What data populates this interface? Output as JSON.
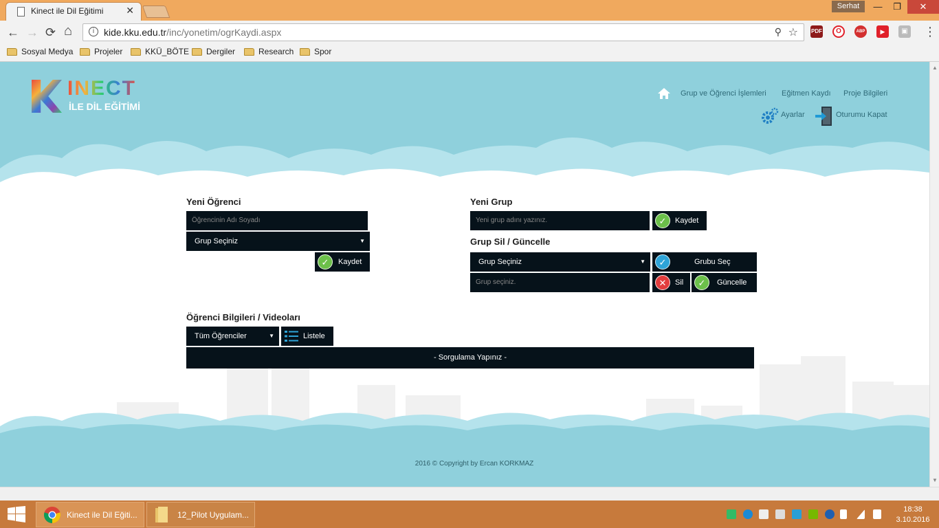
{
  "browser": {
    "tab_title": "Kinect ile Dil Eğitimi",
    "tab_close": "✕",
    "user_name": "Serhat",
    "win_min": "—",
    "win_max": "❐",
    "win_close": "✕",
    "url_domain": "kide.kku.edu.tr",
    "url_path": "/inc/yonetim/ogrKaydi.aspx",
    "back": "←",
    "forward": "→",
    "reload": "⟳",
    "home": "⌂",
    "zoom_icon": "⚲",
    "star_icon": "☆",
    "menu_icon": "⋮",
    "extensions": [
      "PDF",
      "O",
      "ABP",
      "▶",
      "▣"
    ],
    "bookmarks": [
      "Sosyal Medya",
      "Projeler",
      "KKÜ_BÖTE",
      "Dergiler",
      "Research",
      "Spor"
    ]
  },
  "site": {
    "logo_letter": "K",
    "logo_word": "INECT",
    "logo_sub": "İLE DİL EĞİTİMİ",
    "nav": {
      "group_student": "Grup ve Öğrenci İşlemleri",
      "trainer": "Eğitmen Kaydı",
      "project": "Proje Bilgileri",
      "settings": "Ayarlar",
      "logout": "Oturumu Kapat"
    }
  },
  "new_student": {
    "title": "Yeni Öğrenci",
    "name_placeholder": "Öğrencinin Adı Soyadı",
    "group_select": "Grup Seçiniz",
    "save": "Kaydet"
  },
  "new_group": {
    "title": "Yeni Grup",
    "name_placeholder": "Yeni grup adını yazınız.",
    "save": "Kaydet"
  },
  "group_edit": {
    "title": "Grup Sil / Güncelle",
    "group_select": "Grup Seçiniz",
    "select_btn": "Grubu Seç",
    "name_placeholder": "Grup seçiniz.",
    "delete": "Sil",
    "update": "Güncelle"
  },
  "student_info": {
    "title": "Öğrenci Bilgileri / Videoları",
    "filter": "Tüm Öğrenciler",
    "list_btn": "Listele",
    "result": "- Sorgulama Yapınız -"
  },
  "footer": {
    "copyright": "2016 © Copyright by Ercan KORKMAZ"
  },
  "taskbar": {
    "task_chrome": "Kinect ile Dil Eğiti...",
    "task_folder": "12_Pilot Uygulam...",
    "time": "18:38",
    "date": "3.10.2016"
  },
  "colors": {
    "sky": "#8fd0dc",
    "field_bg": "#06121a",
    "ok_green": "#6cc04a",
    "info_blue": "#2ea4d8",
    "danger_red": "#e23d3d",
    "taskbar": "#c77a3c",
    "tabstrip": "#f0a95e"
  }
}
